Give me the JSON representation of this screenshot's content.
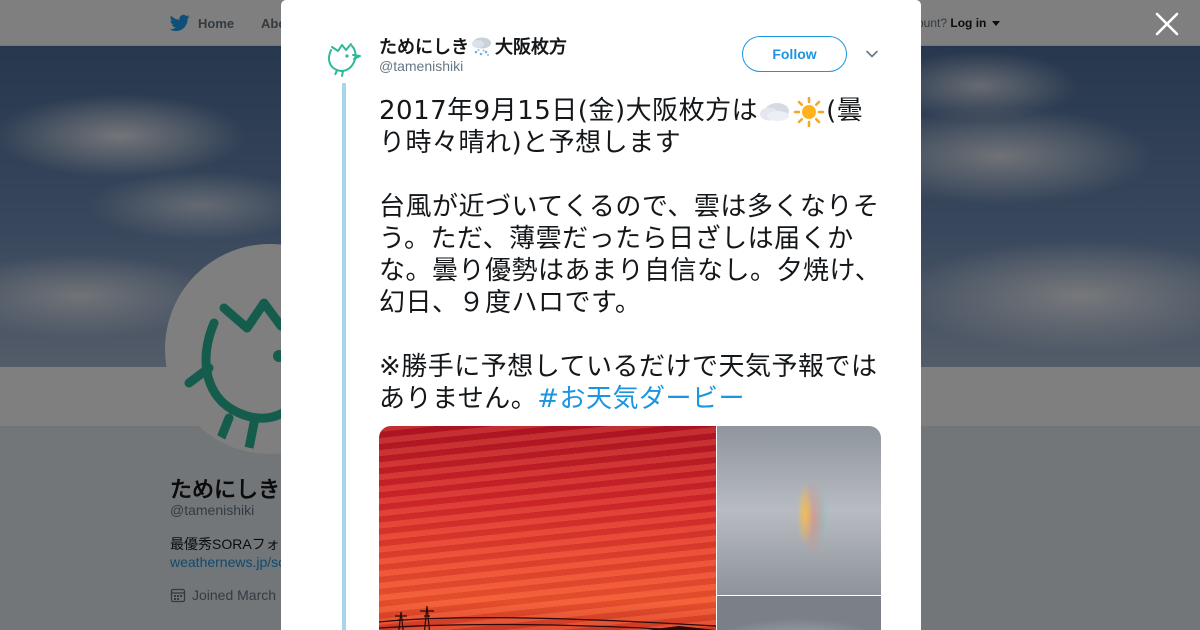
{
  "nav": {
    "home_label": "Home",
    "about_label": "Abo",
    "account_text": "ccount?",
    "login_label": "Log in"
  },
  "profile": {
    "name": "ためにしき",
    "handle": "@tamenishiki",
    "bio": "最優秀SORAフォ",
    "link": "weathernews.jp/so",
    "joined": "Joined March"
  },
  "tweet": {
    "author_name": "ためにしき",
    "author_name_suffix": "大阪枚方",
    "author_handle": "@tamenishiki",
    "follow_label": "Follow",
    "line1_a": "2017年9月15日(金)大阪枚方は",
    "line1_b": "(曇り時々晴れ)と予想します",
    "paragraph2": "台風が近づいてくるので、雲は多くなりそう。ただ、薄雲だったら日ざしは届くかな。曇り優勢はあまり自信なし。夕焼け、幻日、９度ハロです。",
    "paragraph3_text": "※勝手に予想しているだけで天気予報ではありません。",
    "hashtag": "#お天気ダービー"
  },
  "icons": {
    "twitter_bird": "twitter-bird-icon",
    "close": "close-icon",
    "chevron": "chevron-down-icon",
    "calendar": "calendar-icon",
    "cloud_rain_snow": "cloud-snow-rain-icon",
    "cloud": "cloud-icon",
    "sun": "sun-icon"
  },
  "colors": {
    "twitter_blue": "#1da1f2",
    "link_blue": "#1b95e0",
    "thread_line": "#a7d5ea",
    "overlay": "rgba(0,0,0,0.5)"
  }
}
